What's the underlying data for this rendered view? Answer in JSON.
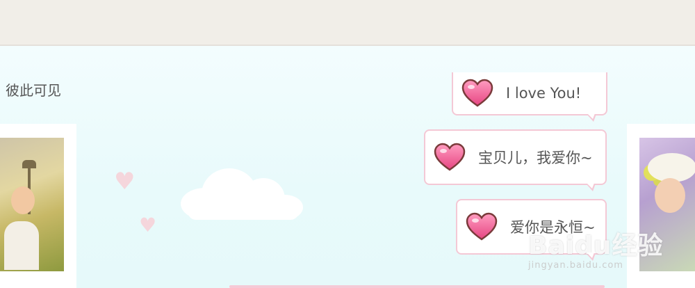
{
  "header": {
    "caption": "彼此可见"
  },
  "messages": [
    {
      "text": "I love You!",
      "icon": "heart-icon"
    },
    {
      "text": "宝贝儿，我爱你~",
      "icon": "heart-icon"
    },
    {
      "text": "爱你是永恒~",
      "icon": "heart-icon"
    }
  ],
  "watermark": {
    "main": "Baidu经验",
    "sub": "jingyan.baidu.com"
  },
  "colors": {
    "accent_pink": "#f4c8d5",
    "heart_pink": "#f06a96",
    "panel_bg": "#eafbfc",
    "topbar_bg": "#f1eee8"
  }
}
